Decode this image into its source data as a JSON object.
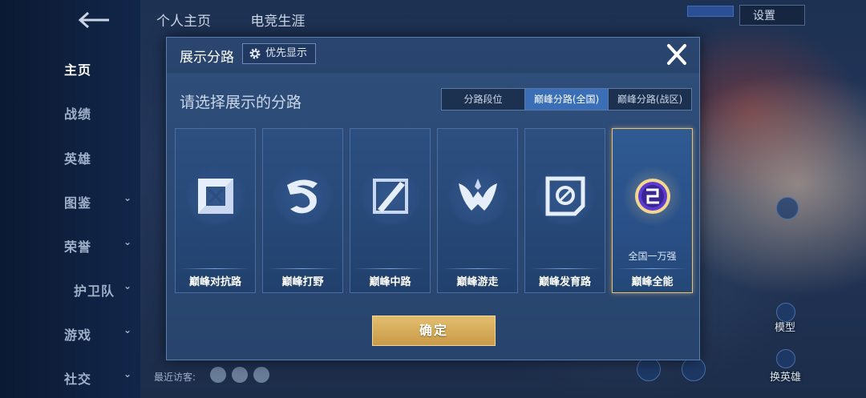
{
  "sidebar": {
    "items": [
      {
        "label": "主页",
        "active": true
      },
      {
        "label": "战绩"
      },
      {
        "label": "英雄"
      },
      {
        "label": "图鉴",
        "chevron": true
      },
      {
        "label": "荣誉",
        "chevron": true
      },
      {
        "label": "护卫队",
        "chevron": true
      },
      {
        "label": "游戏",
        "chevron": true
      },
      {
        "label": "社交",
        "chevron": true
      }
    ]
  },
  "header": {
    "tabs": [
      "个人主页",
      "电竞生涯"
    ],
    "settings_label": "设置"
  },
  "footer": {
    "recent_visitors": "最近访客:"
  },
  "right_panel": {
    "model_label": "模型",
    "change_hero_label": "换英雄"
  },
  "modal": {
    "title": "展示分路",
    "priority_label": "优先显示",
    "subtitle": "请选择展示的分路",
    "segments": [
      "分路段位",
      "巅峰分路(全国)",
      "巅峰分路(战区)"
    ],
    "active_segment": 1,
    "cards": [
      {
        "label": "巅峰对抗路",
        "icon": "sword-shield-icon"
      },
      {
        "label": "巅峰打野",
        "icon": "dragon-icon"
      },
      {
        "label": "巅峰中路",
        "icon": "staff-icon"
      },
      {
        "label": "巅峰游走",
        "icon": "wings-icon"
      },
      {
        "label": "巅峰发育路",
        "icon": "target-icon"
      },
      {
        "label": "巅峰全能",
        "icon": "golden-emblem-icon",
        "rank": "全国一万强",
        "selected": true
      }
    ],
    "confirm_label": "确定"
  },
  "colors": {
    "accent_blue": "#3a6fb8",
    "gold": "#e2bd6e",
    "selected_border": "#e8c36e"
  }
}
